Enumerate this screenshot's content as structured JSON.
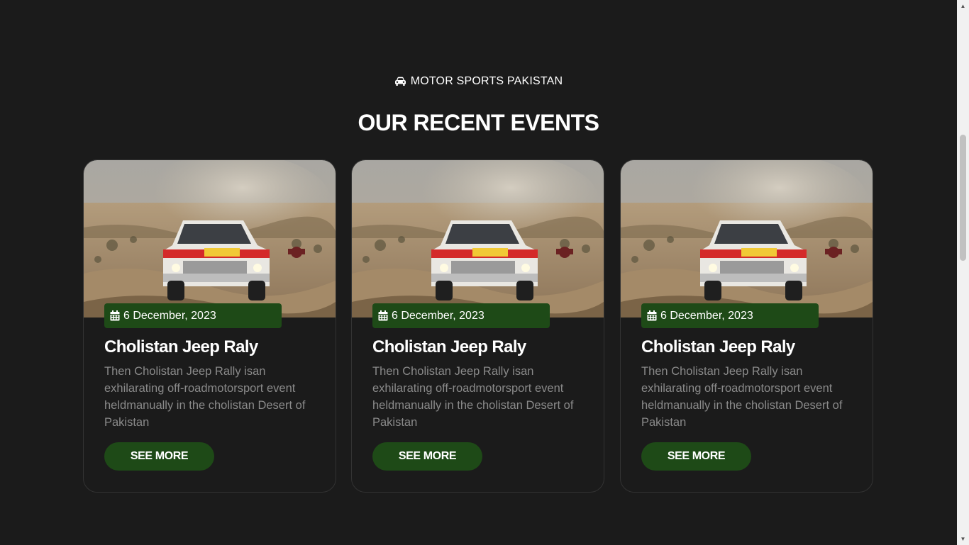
{
  "section": {
    "eyebrow_icon": "car-icon",
    "eyebrow": "MOTOR SPORTS PAKISTAN",
    "heading": "OUR RECENT EVENTS"
  },
  "colors": {
    "background": "#1b1b1b",
    "accent_green": "#1e4a17",
    "body_text": "#8a8a8a"
  },
  "events": [
    {
      "image": "desert-jeep-rally-photo",
      "date_icon": "calendar-icon",
      "date": "6 December, 2023",
      "title": "Cholistan Jeep Raly",
      "description": "Then Cholistan Jeep Rally isan exhilarating off-roadmotorsport event heldmanually in the cholistan Desert of Pakistan",
      "button": "SEE MORE"
    },
    {
      "image": "desert-jeep-rally-photo",
      "date_icon": "calendar-icon",
      "date": "6 December, 2023",
      "title": "Cholistan Jeep Raly",
      "description": "Then Cholistan Jeep Rally isan exhilarating off-roadmotorsport event heldmanually in the cholistan Desert of Pakistan",
      "button": "SEE MORE"
    },
    {
      "image": "desert-jeep-rally-photo",
      "date_icon": "calendar-icon",
      "date": "6 December, 2023",
      "title": "Cholistan Jeep Raly",
      "description": "Then Cholistan Jeep Rally isan exhilarating off-roadmotorsport event heldmanually in the cholistan Desert of Pakistan",
      "button": "SEE MORE"
    }
  ]
}
